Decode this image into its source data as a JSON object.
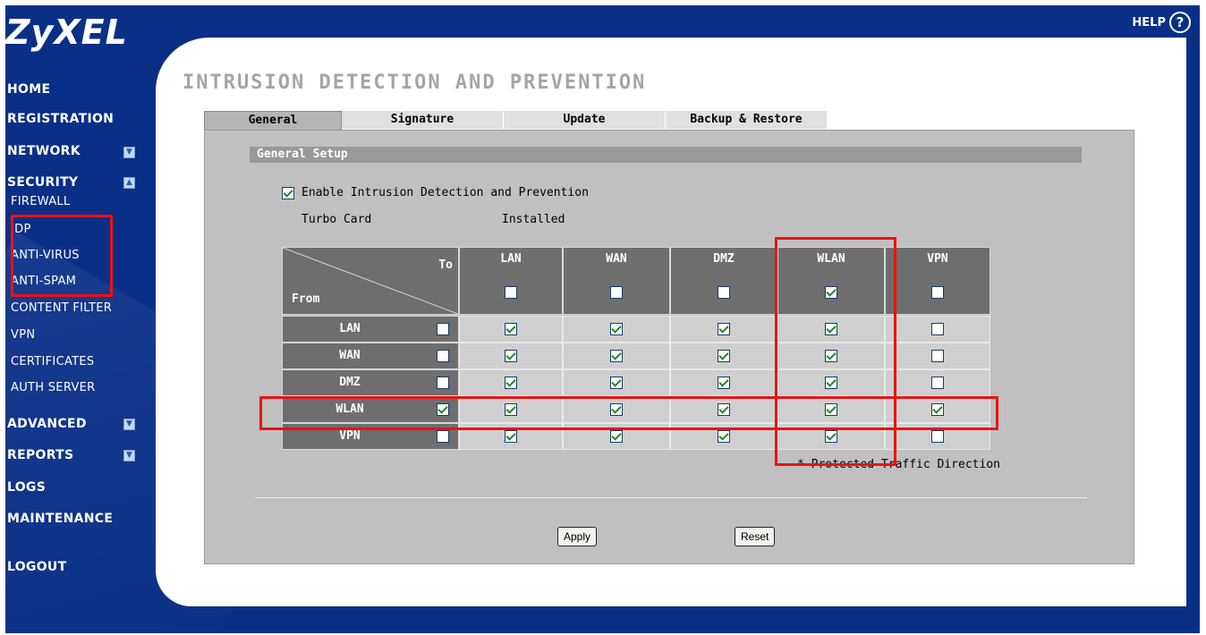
{
  "logo": "ZyXEL",
  "help": {
    "label": "HELP",
    "glyph": "?"
  },
  "nav": {
    "home": "HOME",
    "registration": "REGISTRATION",
    "network": "NETWORK",
    "security": "SECURITY",
    "security_items": [
      "FIREWALL",
      "IDP",
      "ANTI-VIRUS",
      "ANTI-SPAM",
      "CONTENT FILTER",
      "VPN",
      "CERTIFICATES",
      "AUTH SERVER"
    ],
    "advanced": "ADVANCED",
    "reports": "REPORTS",
    "logs": "LOGS",
    "maintenance": "MAINTENANCE",
    "logout": "LOGOUT"
  },
  "page_title": "INTRUSION DETECTION AND PREVENTION",
  "tabs": [
    "General",
    "Signature",
    "Update",
    "Backup & Restore"
  ],
  "active_tab": "General",
  "section_title": "General Setup",
  "enable_label": "Enable Intrusion Detection and Prevention",
  "enable_checked": true,
  "turbo_card": {
    "label": "Turbo Card",
    "value": "Installed"
  },
  "matrix": {
    "to_label": "To",
    "from_label": "From",
    "columns": [
      "LAN",
      "WAN",
      "DMZ",
      "WLAN",
      "VPN"
    ],
    "column_all": [
      false,
      false,
      false,
      true,
      false
    ],
    "rows": [
      {
        "name": "LAN",
        "all": false,
        "cells": [
          true,
          true,
          true,
          true,
          false
        ]
      },
      {
        "name": "WAN",
        "all": false,
        "cells": [
          true,
          true,
          true,
          true,
          false
        ]
      },
      {
        "name": "DMZ",
        "all": false,
        "cells": [
          true,
          true,
          true,
          true,
          false
        ]
      },
      {
        "name": "WLAN",
        "all": true,
        "cells": [
          true,
          true,
          true,
          true,
          true
        ]
      },
      {
        "name": "VPN",
        "all": false,
        "cells": [
          true,
          true,
          true,
          true,
          false
        ]
      }
    ]
  },
  "protected_note": "* Protected Traffic Direction",
  "buttons": {
    "apply": "Apply",
    "reset": "Reset"
  },
  "accent_colors": {
    "nav_bg": "#0a2f86",
    "highlight": "#ee1111"
  }
}
